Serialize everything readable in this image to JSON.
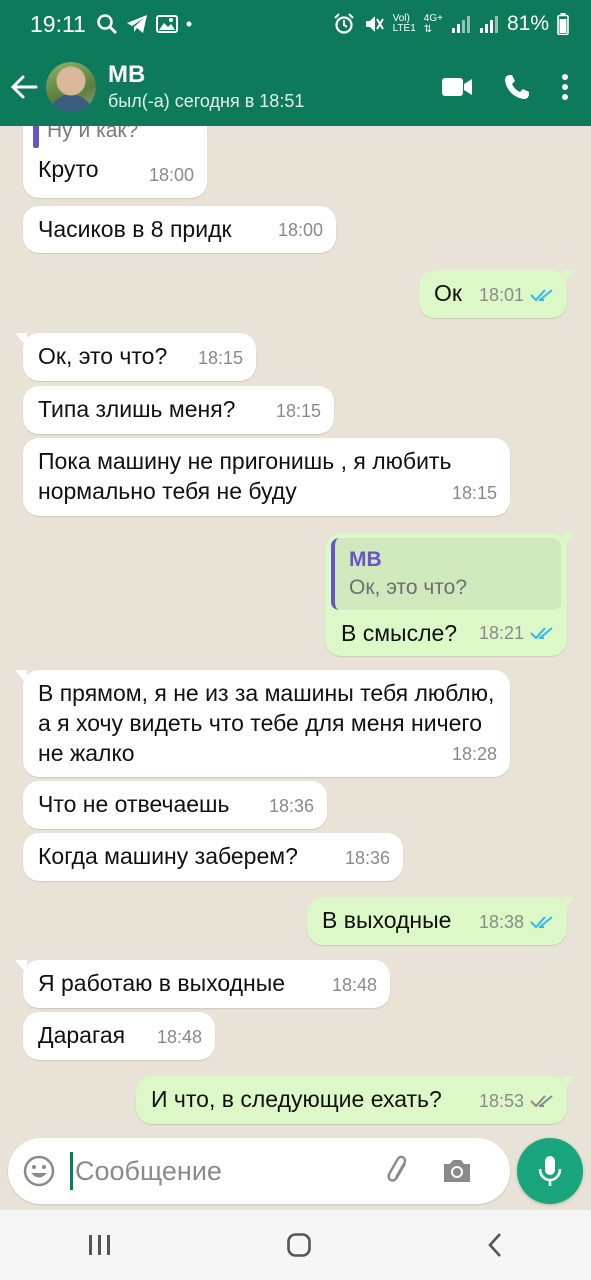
{
  "status_bar": {
    "time": "19:11",
    "dot": "•",
    "volte": "Vol)",
    "lte": "LTE1",
    "net": "4G+",
    "battery": "81%"
  },
  "header": {
    "contact_name": "MB",
    "last_seen": "был(-а) сегодня в 18:51"
  },
  "messages": [
    {
      "dir": "in",
      "text": "Ну и как?",
      "time": "",
      "partial": true
    },
    {
      "dir": "in",
      "text": "Круто",
      "time": "18:00"
    },
    {
      "dir": "in",
      "text": "Часиков в 8 придк",
      "time": "18:00"
    },
    {
      "dir": "out",
      "text": "Ок",
      "time": "18:01",
      "read": true
    },
    {
      "dir": "in",
      "text": "Ок, это что?",
      "time": "18:15"
    },
    {
      "dir": "in",
      "text": "Типа злишь меня?",
      "time": "18:15"
    },
    {
      "dir": "in",
      "text": "Пока машину не пригонишь , я любить нормально тебя не буду",
      "time": "18:15"
    },
    {
      "dir": "out",
      "quote_name": "MB",
      "quote_text": "Ок, это что?",
      "text": "В смысле?",
      "time": "18:21",
      "read": true
    },
    {
      "dir": "in",
      "text": "В прямом, я не из за машины тебя люблю, а я хочу видеть что тебе для меня ничего не жалко",
      "time": "18:28"
    },
    {
      "dir": "in",
      "text": "Что не отвечаешь",
      "time": "18:36"
    },
    {
      "dir": "in",
      "text": "Когда машину заберем?",
      "time": "18:36"
    },
    {
      "dir": "out",
      "text": "В выходные",
      "time": "18:38",
      "read": true
    },
    {
      "dir": "in",
      "text": "Я работаю в выходные",
      "time": "18:48"
    },
    {
      "dir": "in",
      "text": "Дарагая",
      "time": "18:48"
    },
    {
      "dir": "out",
      "text": "И что, в следующие ехать?",
      "time": "18:53",
      "read": false
    }
  ],
  "composer": {
    "placeholder": "Сообщение"
  },
  "colors": {
    "header": "#0e7a5c",
    "outgoing_bubble": "#dcf8c6",
    "incoming_bubble": "#ffffff",
    "read_tick": "#34b7f1",
    "mic_button": "#18a57b"
  },
  "icons": [
    "back-arrow-icon",
    "video-call-icon",
    "phone-icon",
    "more-vert-icon",
    "emoji-icon",
    "attach-icon",
    "camera-icon",
    "mic-icon",
    "recents-icon",
    "home-icon",
    "back-nav-icon"
  ]
}
